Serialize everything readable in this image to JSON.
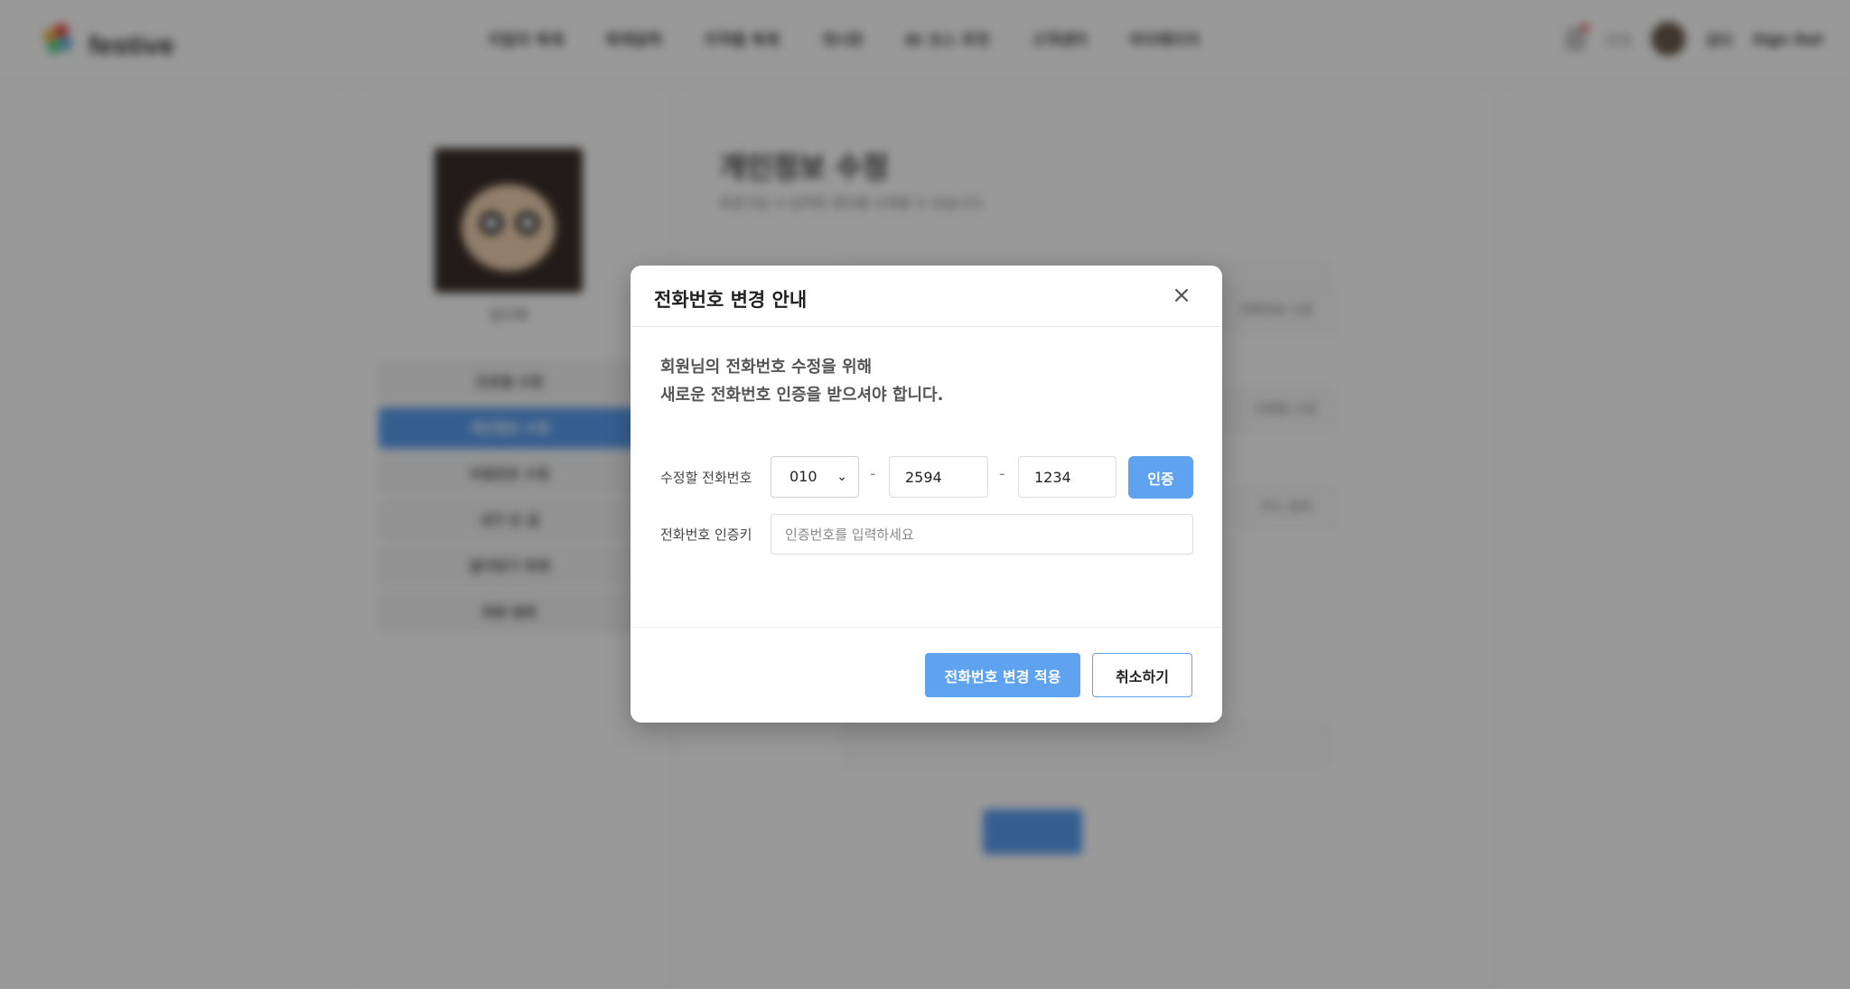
{
  "header": {
    "brand": "festive",
    "nav": [
      "이달의 축제",
      "축제달력",
      "지역별 축제",
      "게시판",
      "AI 코스 추천",
      "고객센터",
      "마이페이지"
    ],
    "notifications_label": "알림",
    "username": "김다",
    "sign_out": "Sign Out"
  },
  "sidebar": {
    "name": "김다희",
    "items": [
      {
        "label": "프로필 수정"
      },
      {
        "label": "개인정보 수정"
      },
      {
        "label": "비밀번호 수정"
      },
      {
        "label": "내가 쓴 글"
      },
      {
        "label": "즐겨찾기 축제"
      },
      {
        "label": "회원 탈퇴"
      }
    ]
  },
  "main": {
    "title": "개인정보 수정",
    "desc": "회원가입 시 입력한 정보를 수정할 수 있습니다.",
    "side_buttons": [
      "전화번호 수정",
      "이메일 수정",
      "주소 검색"
    ]
  },
  "modal": {
    "title": "전화번호 변경 안내",
    "close": "×",
    "message_line1": "회원님의 전화번호 수정을 위해",
    "message_line2": "새로운 전화번호 인증을 받으셔야 합니다.",
    "phone_label": "수정할 전화번호",
    "phone_prefix": "010",
    "phone_middle": "2594",
    "phone_last": "1234",
    "separator": "-",
    "verify_button": "인증",
    "key_label": "전화번호 인증키",
    "key_placeholder": "인증번호를 입력하세요",
    "apply_button": "전화번호 변경 적용",
    "cancel_button": "취소하기"
  },
  "colors": {
    "accent": "#5fa3f0",
    "overlay": "rgba(0,0,0,0.4)"
  }
}
